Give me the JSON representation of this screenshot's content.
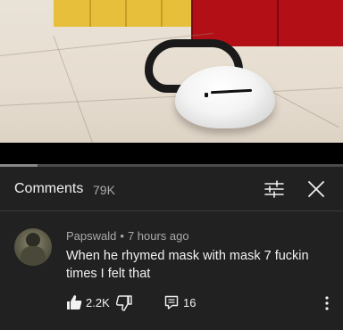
{
  "video": {
    "description_icon": "mask-on-floor-thumbnail",
    "progress_fraction": 0.1
  },
  "comments_header": {
    "title": "Comments",
    "count": "79K",
    "filter_icon": "sliders-icon",
    "close_icon": "close-icon"
  },
  "comment": {
    "author": "Papswald",
    "separator": "•",
    "time": "7 hours ago",
    "text": "When he rhymed mask with mask 7 fuckin times I felt that",
    "likes": "2.2K",
    "replies": "16",
    "like_icon": "thumbs-up-icon",
    "dislike_icon": "thumbs-down-icon",
    "reply_icon": "reply-icon",
    "more_icon": "more-vertical-icon"
  },
  "colors": {
    "background": "#212121",
    "progress_played": "#ff0000",
    "secondary_text": "#aaaaaa",
    "primary_text": "#f1f1f1"
  }
}
